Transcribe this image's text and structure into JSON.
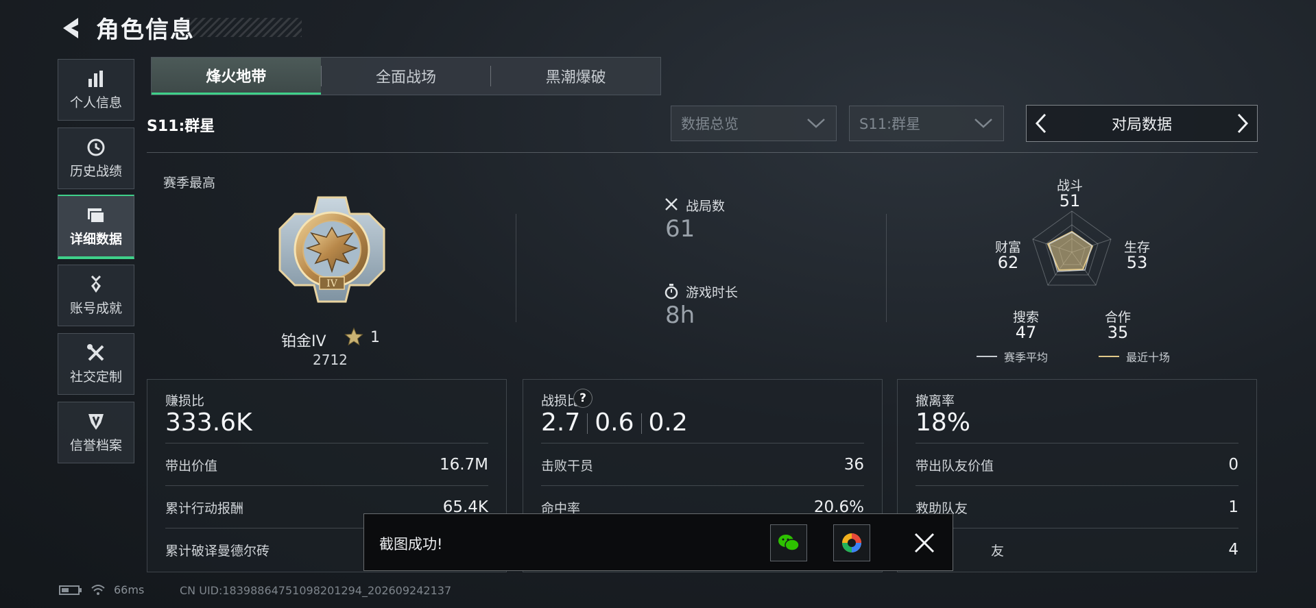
{
  "header": {
    "title": "角色信息"
  },
  "sidebar": {
    "items": [
      {
        "label": "个人信息",
        "icon": "bar-chart-icon",
        "active": false
      },
      {
        "label": "历史战绩",
        "icon": "history-clock-icon",
        "active": false
      },
      {
        "label": "详细数据",
        "icon": "folder-icon",
        "active": true
      },
      {
        "label": "账号成就",
        "icon": "medal-icon",
        "active": false
      },
      {
        "label": "社交定制",
        "icon": "tools-icon",
        "active": false
      },
      {
        "label": "信誉档案",
        "icon": "shield-icon",
        "active": false
      }
    ]
  },
  "tabs": [
    {
      "label": "烽火地带",
      "active": true
    },
    {
      "label": "全面战场",
      "active": false
    },
    {
      "label": "黑潮爆破",
      "active": false
    }
  ],
  "season_label": "S11:群星",
  "filters": {
    "overview": "数据总览",
    "season": "S11:群星",
    "selector": "对局数据"
  },
  "rank": {
    "section_title": "赛季最高",
    "name": "铂金IV",
    "stars": "1",
    "score": "2712",
    "badge_numeral": "IV"
  },
  "stats": {
    "matches_label": "战局数",
    "matches_value": "61",
    "playtime_label": "游戏时长",
    "playtime_value": "8h"
  },
  "radar": {
    "axes": [
      {
        "label": "战斗",
        "value": "51"
      },
      {
        "label": "生存",
        "value": "53"
      },
      {
        "label": "合作",
        "value": "35"
      },
      {
        "label": "搜索",
        "value": "47"
      },
      {
        "label": "财富",
        "value": "62"
      }
    ],
    "legend_season": "赛季平均",
    "legend_recent": "最近十场",
    "season_color": "#c8cdd2",
    "recent_color": "#e2c98a"
  },
  "cards": {
    "profit": {
      "title": "赚损比",
      "value": "333.6K",
      "rows": [
        {
          "label": "带出价值",
          "value": "16.7M"
        },
        {
          "label": "累计行动报酬",
          "value": "65.4K"
        },
        {
          "label": "累计破译曼德尔砖",
          "value": ""
        }
      ]
    },
    "combat": {
      "title": "战损比",
      "ratios": [
        "2.7",
        "0.6",
        "0.2"
      ],
      "help": "?",
      "rows": [
        {
          "label": "击败干员",
          "value": "36"
        },
        {
          "label": "命中率",
          "value": "20.6%"
        }
      ]
    },
    "extract": {
      "title": "撤离率",
      "value": "18%",
      "rows": [
        {
          "label": "带出队友价值",
          "value": "0"
        },
        {
          "label": "救助队友",
          "value": "1"
        },
        {
          "label": "友",
          "value": "4"
        }
      ]
    }
  },
  "footer": {
    "ping": "66ms",
    "uid": "CN UID:1839886475109820​1294_202609242137"
  },
  "toast": {
    "message": "截图成功!"
  },
  "colors": {
    "accent": "#3fd18a",
    "background": "#1c2127"
  }
}
